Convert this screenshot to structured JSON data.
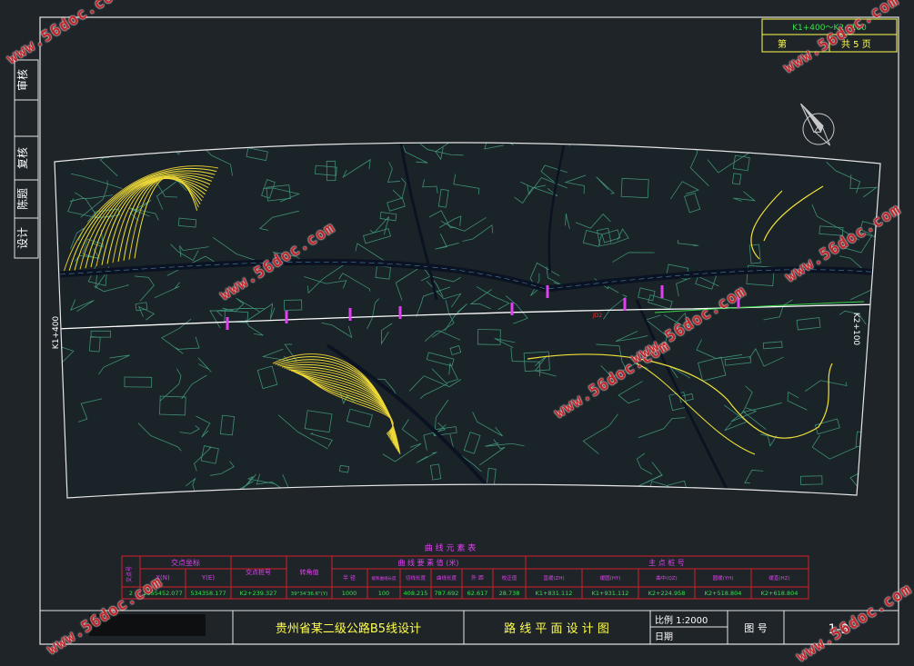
{
  "drawing": {
    "stake_range": "K1+400～K2+100",
    "sheet_no": "第",
    "sheet_total": "共 5 页",
    "stake_start": "K1+400",
    "stake_end": "K2+100",
    "project": "贵州省某二级公路B5线设计",
    "title": "路 线 平 面 设 计 图",
    "scale": "比例 1:2000",
    "date": "日期",
    "fig_label": "图 号",
    "fig_no": "1-3"
  },
  "signature_labels": [
    "审核",
    "复核",
    "陈题",
    "设计"
  ],
  "curve_table": {
    "title": "曲 线 元 素 表",
    "h_index": "交点号",
    "h_coord_group": "交点坐标",
    "h_x": "X(N)",
    "h_y": "Y(E)",
    "h_station": "交点桩号",
    "h_angle": "转角值",
    "h_elem_group": "曲 线 要 素 值 (米)",
    "h_radius": "半 径",
    "h_spiral": "缓和曲线长度",
    "h_tangent": "切线长度",
    "h_curve_len": "曲线长度",
    "h_external": "外 距",
    "h_correction": "校正值",
    "h_points_group": "主 点 桩 号",
    "h_zh": "直缓(ZH)",
    "h_hy": "缓圆(HY)",
    "h_qz": "曲中(QZ)",
    "h_yh": "圆缓(YH)",
    "h_hz": "缓直(HZ)",
    "row": {
      "index": "2",
      "x": "2955452.077",
      "y": "534358.177",
      "station": "K2+239.327",
      "angle": "39°34'36.6\"(Y)",
      "radius": "1000",
      "spiral": "100",
      "tangent": "408.215",
      "curve_len": "787.692",
      "external": "62.617",
      "correction": "28.738",
      "zh": "K1+831.112",
      "hy": "K1+931.112",
      "qz": "K2+224.958",
      "yh": "K2+518.804",
      "hz": "K2+618.804"
    }
  },
  "watermarks": [
    "www.56doc.com",
    "www.56doc.com",
    "www.56doc.com",
    "www.56doc.com",
    "www.56doc.com",
    "www.56doc.com",
    "www.56doc.com",
    "www.56doc.com"
  ],
  "colors": {
    "background": "#1f2429",
    "frame": "#e8e8e8",
    "table_border": "#d4202a",
    "table_header": "#e23ff0",
    "table_values": "#36e04a",
    "contour_yellow": "#f2e23a",
    "road": "#0b1322",
    "terrain": "#3f8f79",
    "title_block": "#ffff4a",
    "watermark": "#c0262b"
  },
  "icons": [
    "north-arrow-icon"
  ]
}
